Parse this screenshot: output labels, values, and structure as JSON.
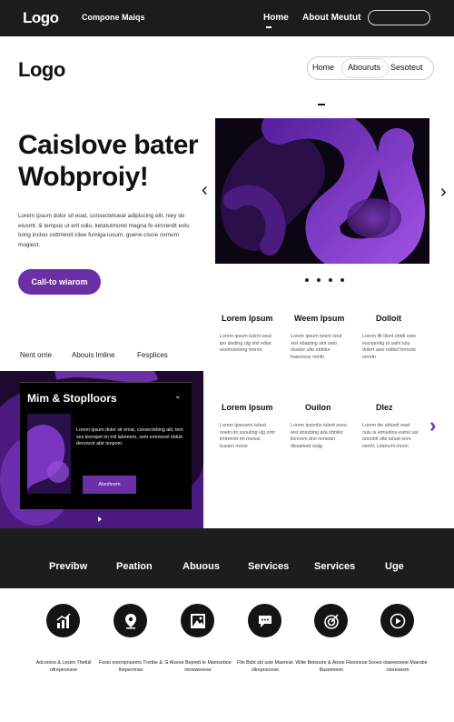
{
  "topbar": {
    "logo": "Logo",
    "company": "Compone Maiqs",
    "nav_home": "Home",
    "nav_about": "About Meutut"
  },
  "header": {
    "logo": "Logo",
    "nav": [
      "Home",
      "Abouruts",
      "Sesoteut"
    ]
  },
  "hero": {
    "title": "Caislove bater Wobproiy!",
    "text": "Lorem ipsum dolor sit eoat, consectetuear adipiscing elit, niey do eiusmt. & tempus ut erit odio, ketatutmoret magna fo eircrenitt ests tuing inctoo cottmenit ciiee fumiga iusum, guene ciscie osmum mogiest.",
    "cta": "Call-to wiarom",
    "dots": 4,
    "accent": "#6b2fa6"
  },
  "mid_links": [
    "Nent orrie",
    "Abouis lmline",
    "Fesplices"
  ],
  "features_top": [
    {
      "title": "Lorem Ipsum",
      "text": "Lorem ipsum tulent oeut ipo sloding ulg ohil ediat asomosionrg mnnm"
    },
    {
      "title": "Weem Ipsum",
      "text": "Lorem ipsum tvlent sout eist ebasting slnt oeto dosdor uito obbilor huiemosy mmlh"
    },
    {
      "title": "Dolloit",
      "text": "Lorem ifit tlient ebtdi esto escoprelig ut saihi tulu dolert asio oddsil hemote mmrth"
    }
  ],
  "features_bottom": [
    {
      "title": "Lorem Ipsum",
      "text": "Lorem ipseuem tuleut ooein do ssouting ulg orbt imiremet mt meiusi, busam moon"
    },
    {
      "title": "Ouilon",
      "text": "Lorem ipsenlie tulent esea eist dossbing aila obbilor liennem drsi mmetan dissatsod sojig."
    },
    {
      "title": "Dlez",
      "text": "Lorem itie abtoelt eaet nulu is etmudiou eamo asi tutoobit otbi tuluat sorn nemtl, Lbseumi moon"
    }
  ],
  "panel": {
    "title": "Mim & Stoplloors",
    "text": "Lorem ipsum dolor sit emat, consectetiing alit, tem ses teempet im tnil labeeere, sem emmenel ebtub deruncnt abir tenpom.",
    "button": "Alsnfinom"
  },
  "band": [
    "Previbw",
    "Peation",
    "Abuous",
    "Services",
    "Services",
    "Uge"
  ],
  "icons": [
    {
      "icon": "chart-bars-icon",
      "caption": "Adcorons & Lestre Thefull ollrepeonsoe"
    },
    {
      "icon": "location-pin-icon",
      "caption": "Fsoio eonmpnueers Trsrtbe & Iheperrmse"
    },
    {
      "icon": "image-icon",
      "caption": "G Alsese Beprett Ie Mamseboe ninniweeese"
    },
    {
      "icon": "chat-bubble-icon",
      "caption": "Flin Bsbt sbl sole Maeresk ollrepoeoose"
    },
    {
      "icon": "target-icon",
      "caption": "Wiite Belsoore & Atooe Fbeonsoe Baseimeon"
    },
    {
      "icon": "play-circle-icon",
      "caption": "Sooeo olaeeeoeoe Maeobe otoresesm"
    }
  ]
}
